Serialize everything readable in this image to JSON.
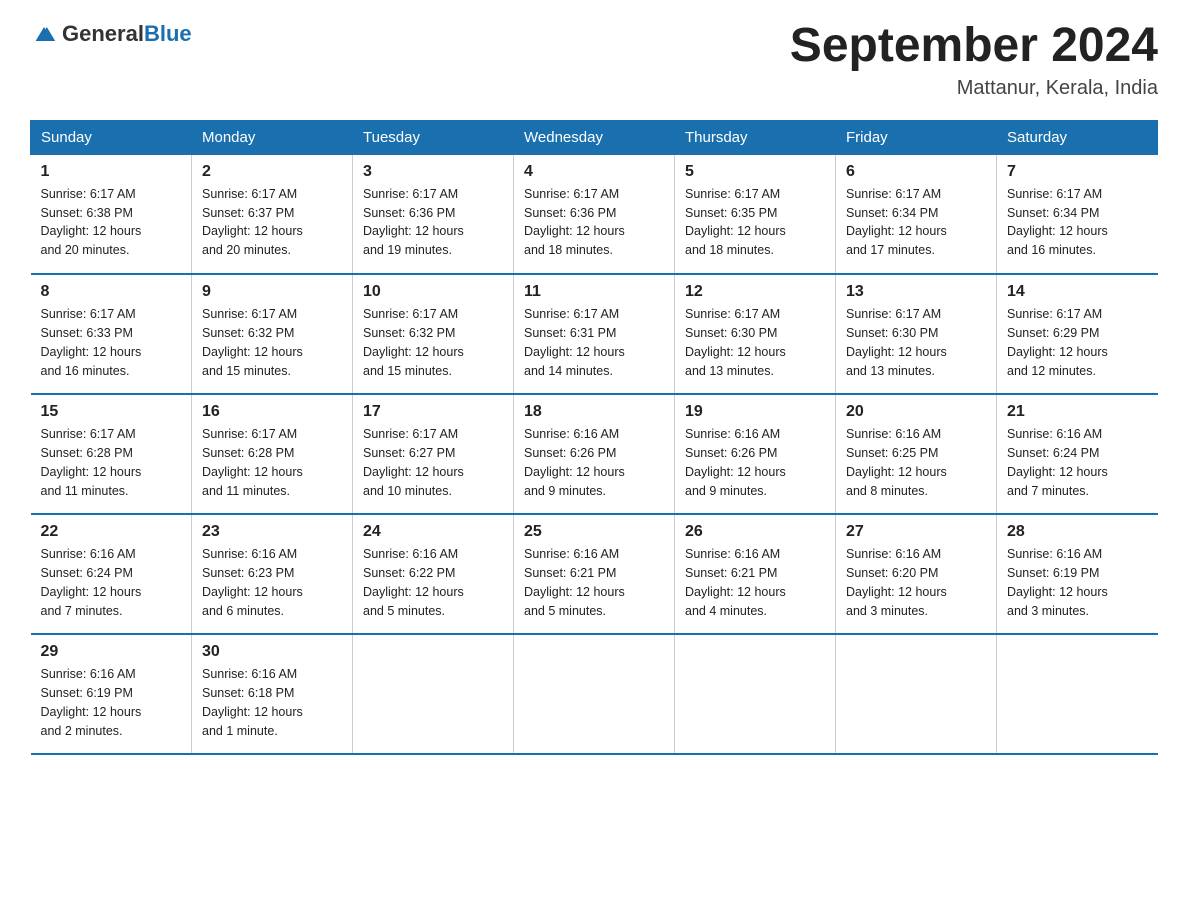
{
  "logo": {
    "general": "General",
    "blue": "Blue"
  },
  "title": "September 2024",
  "location": "Mattanur, Kerala, India",
  "headers": [
    "Sunday",
    "Monday",
    "Tuesday",
    "Wednesday",
    "Thursday",
    "Friday",
    "Saturday"
  ],
  "weeks": [
    [
      {
        "day": "1",
        "sunrise": "6:17 AM",
        "sunset": "6:38 PM",
        "daylight": "12 hours and 20 minutes."
      },
      {
        "day": "2",
        "sunrise": "6:17 AM",
        "sunset": "6:37 PM",
        "daylight": "12 hours and 20 minutes."
      },
      {
        "day": "3",
        "sunrise": "6:17 AM",
        "sunset": "6:36 PM",
        "daylight": "12 hours and 19 minutes."
      },
      {
        "day": "4",
        "sunrise": "6:17 AM",
        "sunset": "6:36 PM",
        "daylight": "12 hours and 18 minutes."
      },
      {
        "day": "5",
        "sunrise": "6:17 AM",
        "sunset": "6:35 PM",
        "daylight": "12 hours and 18 minutes."
      },
      {
        "day": "6",
        "sunrise": "6:17 AM",
        "sunset": "6:34 PM",
        "daylight": "12 hours and 17 minutes."
      },
      {
        "day": "7",
        "sunrise": "6:17 AM",
        "sunset": "6:34 PM",
        "daylight": "12 hours and 16 minutes."
      }
    ],
    [
      {
        "day": "8",
        "sunrise": "6:17 AM",
        "sunset": "6:33 PM",
        "daylight": "12 hours and 16 minutes."
      },
      {
        "day": "9",
        "sunrise": "6:17 AM",
        "sunset": "6:32 PM",
        "daylight": "12 hours and 15 minutes."
      },
      {
        "day": "10",
        "sunrise": "6:17 AM",
        "sunset": "6:32 PM",
        "daylight": "12 hours and 15 minutes."
      },
      {
        "day": "11",
        "sunrise": "6:17 AM",
        "sunset": "6:31 PM",
        "daylight": "12 hours and 14 minutes."
      },
      {
        "day": "12",
        "sunrise": "6:17 AM",
        "sunset": "6:30 PM",
        "daylight": "12 hours and 13 minutes."
      },
      {
        "day": "13",
        "sunrise": "6:17 AM",
        "sunset": "6:30 PM",
        "daylight": "12 hours and 13 minutes."
      },
      {
        "day": "14",
        "sunrise": "6:17 AM",
        "sunset": "6:29 PM",
        "daylight": "12 hours and 12 minutes."
      }
    ],
    [
      {
        "day": "15",
        "sunrise": "6:17 AM",
        "sunset": "6:28 PM",
        "daylight": "12 hours and 11 minutes."
      },
      {
        "day": "16",
        "sunrise": "6:17 AM",
        "sunset": "6:28 PM",
        "daylight": "12 hours and 11 minutes."
      },
      {
        "day": "17",
        "sunrise": "6:17 AM",
        "sunset": "6:27 PM",
        "daylight": "12 hours and 10 minutes."
      },
      {
        "day": "18",
        "sunrise": "6:16 AM",
        "sunset": "6:26 PM",
        "daylight": "12 hours and 9 minutes."
      },
      {
        "day": "19",
        "sunrise": "6:16 AM",
        "sunset": "6:26 PM",
        "daylight": "12 hours and 9 minutes."
      },
      {
        "day": "20",
        "sunrise": "6:16 AM",
        "sunset": "6:25 PM",
        "daylight": "12 hours and 8 minutes."
      },
      {
        "day": "21",
        "sunrise": "6:16 AM",
        "sunset": "6:24 PM",
        "daylight": "12 hours and 7 minutes."
      }
    ],
    [
      {
        "day": "22",
        "sunrise": "6:16 AM",
        "sunset": "6:24 PM",
        "daylight": "12 hours and 7 minutes."
      },
      {
        "day": "23",
        "sunrise": "6:16 AM",
        "sunset": "6:23 PM",
        "daylight": "12 hours and 6 minutes."
      },
      {
        "day": "24",
        "sunrise": "6:16 AM",
        "sunset": "6:22 PM",
        "daylight": "12 hours and 5 minutes."
      },
      {
        "day": "25",
        "sunrise": "6:16 AM",
        "sunset": "6:21 PM",
        "daylight": "12 hours and 5 minutes."
      },
      {
        "day": "26",
        "sunrise": "6:16 AM",
        "sunset": "6:21 PM",
        "daylight": "12 hours and 4 minutes."
      },
      {
        "day": "27",
        "sunrise": "6:16 AM",
        "sunset": "6:20 PM",
        "daylight": "12 hours and 3 minutes."
      },
      {
        "day": "28",
        "sunrise": "6:16 AM",
        "sunset": "6:19 PM",
        "daylight": "12 hours and 3 minutes."
      }
    ],
    [
      {
        "day": "29",
        "sunrise": "6:16 AM",
        "sunset": "6:19 PM",
        "daylight": "12 hours and 2 minutes."
      },
      {
        "day": "30",
        "sunrise": "6:16 AM",
        "sunset": "6:18 PM",
        "daylight": "12 hours and 1 minute."
      },
      null,
      null,
      null,
      null,
      null
    ]
  ],
  "labels": {
    "sunrise": "Sunrise:",
    "sunset": "Sunset:",
    "daylight": "Daylight:"
  }
}
